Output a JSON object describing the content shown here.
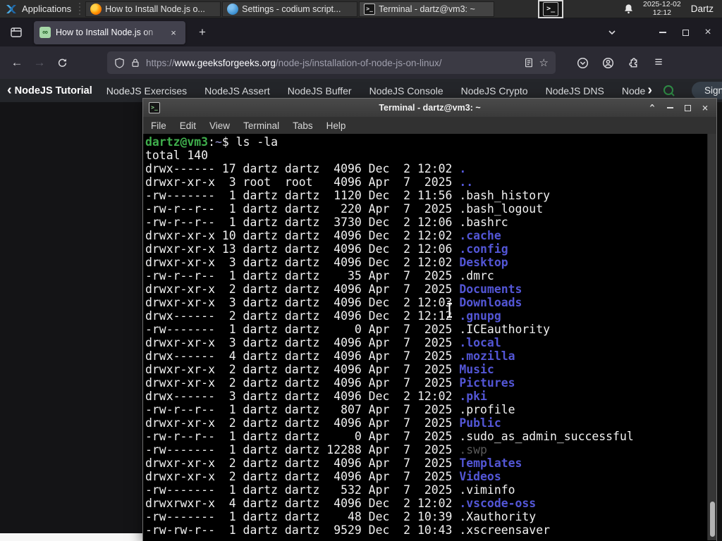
{
  "colors": {
    "prompt_green": "#3fae4c",
    "prompt_path": "#9b9bd8",
    "dir_blue": "#5356d6",
    "term_fg": "#f1f1f1",
    "term_dim": "#5a5a5a",
    "gfg_green": "#2f8d46",
    "codium_blue": "#3a8fd0"
  },
  "glyphs": {
    "back": "←",
    "forward": "→",
    "star": "☆",
    "hamburger": "≡",
    "plus": "+",
    "close": "×",
    "chevron_left": "‹",
    "chevron_right": "›",
    "shade": "^",
    "terminal": ">_",
    "favicon": "∞"
  },
  "panel": {
    "applications_label": "Applications",
    "tasks": [
      {
        "icon": "firefox",
        "label": "How to Install Node.js o..."
      },
      {
        "icon": "codium",
        "label": "Settings - codium script..."
      },
      {
        "icon": "terminal",
        "label": "Terminal - dartz@vm3: ~",
        "active": true
      }
    ],
    "clock_date": "2025-12-02",
    "clock_time": "12:12",
    "user_label": "Dartz"
  },
  "browser": {
    "tab_title": "How to Install Node.js on",
    "url_scheme": "https://",
    "url_host": "www.geeksforgeeks.org",
    "url_path": "/node-js/installation-of-node-js-on-linux/"
  },
  "gfg_nav": {
    "primary": "NodeJS Tutorial",
    "items": [
      "NodeJS Exercises",
      "NodeJS Assert",
      "NodeJS Buffer",
      "NodeJS Console",
      "NodeJS Crypto",
      "NodeJS DNS",
      "Node"
    ],
    "sign_in_label": "Sign In"
  },
  "terminal": {
    "window_title": "Terminal - dartz@vm3: ~",
    "menu_items": [
      "File",
      "Edit",
      "View",
      "Terminal",
      "Tabs",
      "Help"
    ],
    "prompt_user": "dartz@vm3",
    "prompt_sep": ":",
    "prompt_path": "~",
    "prompt_cmd": "$ ls -la",
    "total_line": "total 140",
    "entries": [
      {
        "meta": "drwx------ 17 dartz dartz  4096 Dec  2 12:02 ",
        "name": ".",
        "kind": "dir"
      },
      {
        "meta": "drwxr-xr-x  3 root  root   4096 Apr  7  2025 ",
        "name": "..",
        "kind": "dir"
      },
      {
        "meta": "-rw-------  1 dartz dartz  1120 Dec  2 11:56 ",
        "name": ".bash_history",
        "kind": "file"
      },
      {
        "meta": "-rw-r--r--  1 dartz dartz   220 Apr  7  2025 ",
        "name": ".bash_logout",
        "kind": "file"
      },
      {
        "meta": "-rw-r--r--  1 dartz dartz  3730 Dec  2 12:06 ",
        "name": ".bashrc",
        "kind": "file"
      },
      {
        "meta": "drwxr-xr-x 10 dartz dartz  4096 Dec  2 12:02 ",
        "name": ".cache",
        "kind": "dir"
      },
      {
        "meta": "drwxr-xr-x 13 dartz dartz  4096 Dec  2 12:06 ",
        "name": ".config",
        "kind": "dir"
      },
      {
        "meta": "drwxr-xr-x  3 dartz dartz  4096 Dec  2 12:02 ",
        "name": "Desktop",
        "kind": "dir"
      },
      {
        "meta": "-rw-r--r--  1 dartz dartz    35 Apr  7  2025 ",
        "name": ".dmrc",
        "kind": "file"
      },
      {
        "meta": "drwxr-xr-x  2 dartz dartz  4096 Apr  7  2025 ",
        "name": "Documents",
        "kind": "dir"
      },
      {
        "meta": "drwxr-xr-x  3 dartz dartz  4096 Dec  2 12:03 ",
        "name": "Downloads",
        "kind": "dir"
      },
      {
        "meta": "drwx------  2 dartz dartz  4096 Dec  2 12:12 ",
        "name": ".gnupg",
        "kind": "dir"
      },
      {
        "meta": "-rw-------  1 dartz dartz     0 Apr  7  2025 ",
        "name": ".ICEauthority",
        "kind": "file"
      },
      {
        "meta": "drwxr-xr-x  3 dartz dartz  4096 Apr  7  2025 ",
        "name": ".local",
        "kind": "dir"
      },
      {
        "meta": "drwx------  4 dartz dartz  4096 Apr  7  2025 ",
        "name": ".mozilla",
        "kind": "dir"
      },
      {
        "meta": "drwxr-xr-x  2 dartz dartz  4096 Apr  7  2025 ",
        "name": "Music",
        "kind": "dir"
      },
      {
        "meta": "drwxr-xr-x  2 dartz dartz  4096 Apr  7  2025 ",
        "name": "Pictures",
        "kind": "dir"
      },
      {
        "meta": "drwx------  3 dartz dartz  4096 Dec  2 12:02 ",
        "name": ".pki",
        "kind": "dir"
      },
      {
        "meta": "-rw-r--r--  1 dartz dartz   807 Apr  7  2025 ",
        "name": ".profile",
        "kind": "file"
      },
      {
        "meta": "drwxr-xr-x  2 dartz dartz  4096 Apr  7  2025 ",
        "name": "Public",
        "kind": "dir"
      },
      {
        "meta": "-rw-r--r--  1 dartz dartz     0 Apr  7  2025 ",
        "name": ".sudo_as_admin_successful",
        "kind": "file"
      },
      {
        "meta": "-rw-------  1 dartz dartz 12288 Apr  7  2025 ",
        "name": ".swp",
        "kind": "dim"
      },
      {
        "meta": "drwxr-xr-x  2 dartz dartz  4096 Apr  7  2025 ",
        "name": "Templates",
        "kind": "dir"
      },
      {
        "meta": "drwxr-xr-x  2 dartz dartz  4096 Apr  7  2025 ",
        "name": "Videos",
        "kind": "dir"
      },
      {
        "meta": "-rw-------  1 dartz dartz   532 Apr  7  2025 ",
        "name": ".viminfo",
        "kind": "file"
      },
      {
        "meta": "drwxrwxr-x  4 dartz dartz  4096 Dec  2 12:02 ",
        "name": ".vscode-oss",
        "kind": "dir"
      },
      {
        "meta": "-rw-------  1 dartz dartz    48 Dec  2 10:39 ",
        "name": ".Xauthority",
        "kind": "file"
      },
      {
        "meta": "-rw-rw-r--  1 dartz dartz  9529 Dec  2 10:43 ",
        "name": ".xscreensaver",
        "kind": "file"
      }
    ]
  }
}
